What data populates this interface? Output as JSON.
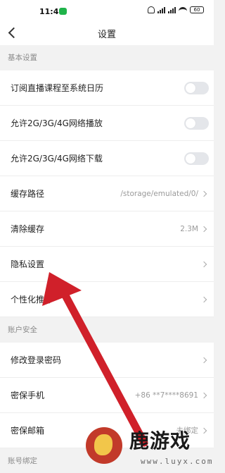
{
  "status_bar": {
    "time": "11:46",
    "battery": "60"
  },
  "header": {
    "title": "设置"
  },
  "sections": {
    "basic": {
      "header": "基本设置",
      "subscribe_calendar": "订阅直播课程至系统日历",
      "allow_mobile_play": "允许2G/3G/4G网络播放",
      "allow_mobile_download": "允许2G/3G/4G网络下载",
      "cache_path_label": "缓存路径",
      "cache_path_value": "/storage/emulated/0/",
      "clear_cache_label": "清除缓存",
      "clear_cache_value": "2.3M",
      "privacy_label": "隐私设置",
      "personalization_label": "个性化推荐"
    },
    "account": {
      "header": "账户安全",
      "change_password": "修改登录密码",
      "phone_label": "密保手机",
      "phone_value": "+86 **7****8691",
      "email_label": "密保邮箱",
      "email_value": "未绑定"
    },
    "binding": {
      "header": "账号绑定"
    }
  },
  "toggles": {
    "subscribe_calendar": false,
    "allow_mobile_play": false,
    "allow_mobile_download": false
  },
  "colors": {
    "toggle_off": "#e4e6ea",
    "arrow": "#d0202a",
    "section_bg": "#f2f2f2"
  },
  "watermark": {
    "brand": "鹿游戏",
    "url": "www.luyx.com"
  }
}
